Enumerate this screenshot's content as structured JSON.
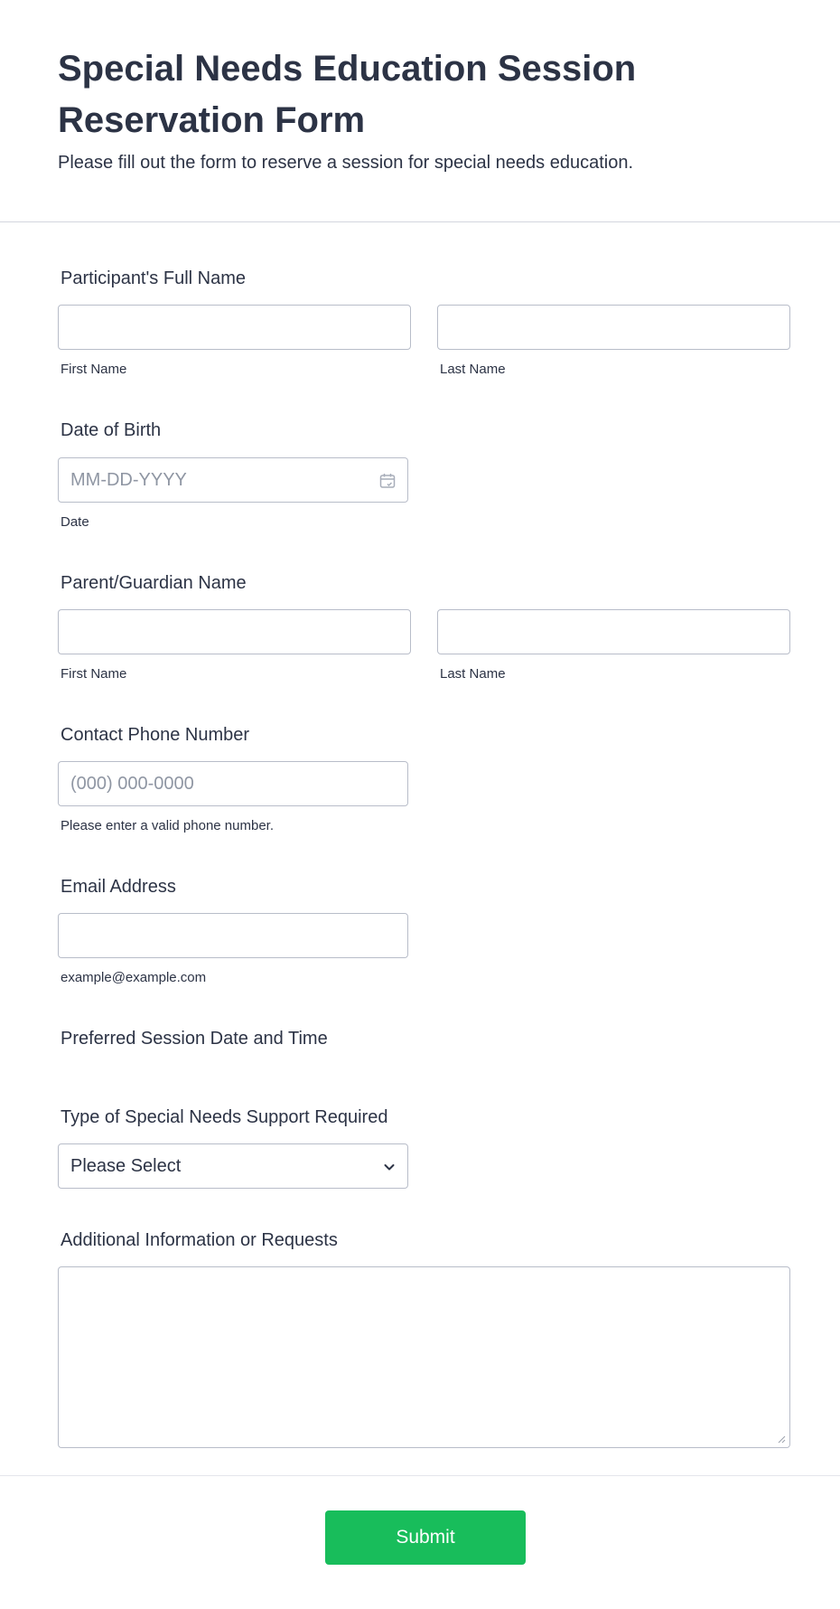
{
  "header": {
    "title": "Special Needs Education Session Reservation Form",
    "subtitle": "Please fill out the form to reserve a session for special needs education."
  },
  "participant_name": {
    "label": "Participant's Full Name",
    "first_sublabel": "First Name",
    "last_sublabel": "Last Name",
    "first_value": "",
    "last_value": ""
  },
  "date_of_birth": {
    "label": "Date of Birth",
    "placeholder": "MM-DD-YYYY",
    "sublabel": "Date",
    "icon": "calendar-icon"
  },
  "guardian_name": {
    "label": "Parent/Guardian Name",
    "first_sublabel": "First Name",
    "last_sublabel": "Last Name",
    "first_value": "",
    "last_value": ""
  },
  "phone": {
    "label": "Contact Phone Number",
    "placeholder": "(000) 000-0000",
    "sublabel": "Please enter a valid phone number."
  },
  "email": {
    "label": "Email Address",
    "sublabel": "example@example.com",
    "value": ""
  },
  "session_datetime": {
    "label": "Preferred Session Date and Time"
  },
  "support_type": {
    "label": "Type of Special Needs Support Required",
    "selected": "Please Select",
    "icon": "chevron-down-icon"
  },
  "additional_info": {
    "label": "Additional Information or Requests",
    "value": ""
  },
  "submit": {
    "label": "Submit"
  },
  "colors": {
    "text": "#2c3345",
    "border": "#b8bdc9",
    "placeholder": "#8f96a3",
    "submit_bg": "#18bd5b"
  }
}
